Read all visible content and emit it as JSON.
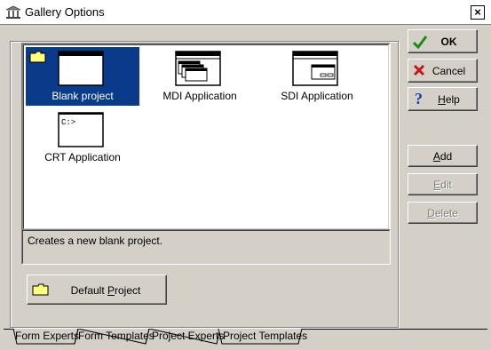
{
  "window": {
    "title": "Gallery Options",
    "close_glyph": "×"
  },
  "gallery": {
    "items": [
      {
        "label": "Blank project",
        "icon": "blank-project-icon",
        "selected": true
      },
      {
        "label": "MDI Application",
        "icon": "mdi-application-icon",
        "selected": false
      },
      {
        "label": "SDI Application",
        "icon": "sdi-application-icon",
        "selected": false
      },
      {
        "label": "CRT Application",
        "icon": "crt-application-icon",
        "selected": false,
        "screen_text": "C:>"
      }
    ]
  },
  "description": "Creates a new blank project.",
  "default_project": {
    "label_pre": "Default ",
    "label_key": "P",
    "label_post": "roject"
  },
  "buttons": {
    "ok": "OK",
    "cancel": "Cancel",
    "help_key": "H",
    "help_rest": "elp",
    "add_key": "A",
    "add_rest": "dd",
    "edit_key": "E",
    "edit_rest": "dit",
    "delete_key": "D",
    "delete_rest": "elete"
  },
  "tabs": [
    "Form Experts",
    "Form Templates",
    "Project Experts",
    "Project Templates"
  ],
  "active_tab": "Project Templates",
  "colors": {
    "selection": "#0a3a8a",
    "face": "#d4d0c8",
    "ok_check": "#1a8a1a",
    "cancel_x": "#c01818",
    "help_q": "#1a3aa8"
  }
}
